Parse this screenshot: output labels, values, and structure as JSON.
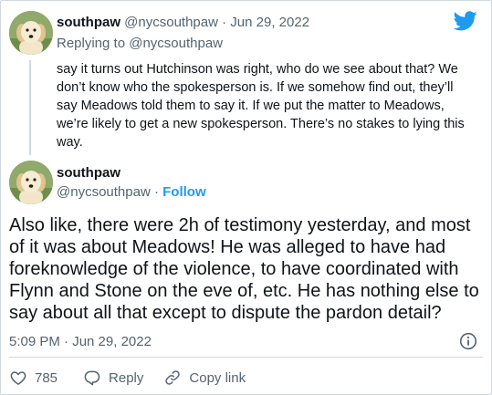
{
  "colors": {
    "accent": "#1d9bf0",
    "muted": "#536471",
    "text": "#0f1419",
    "border": "#cfd9de"
  },
  "icons": {
    "brand": "twitter-bird-icon",
    "info": "info-icon",
    "like": "heart-icon",
    "reply": "reply-icon",
    "copy": "link-icon"
  },
  "parent_tweet": {
    "name": "southpaw",
    "handle": "@nycsouthpaw",
    "separator": " · ",
    "date": "Jun 29, 2022",
    "replying_prefix": "Replying to ",
    "replying_to": "@nycsouthpaw",
    "text": "say it turns out Hutchinson was right, who do we see about that? We don’t know who the spokesperson is. If we somehow find out, they’ll say Meadows told them to say it. If we put the matter to Meadows, we’re likely to get a new spokesperson. There’s no stakes to lying this way."
  },
  "main_tweet": {
    "name": "southpaw",
    "handle": "@nycsouthpaw",
    "separator": " · ",
    "follow_label": "Follow",
    "text": "Also like, there were 2h of testimony yesterday, and most of it was about Meadows! He was alleged to have had foreknowledge of the violence, to have coordinated with Flynn and Stone on the eve of, etc. He has nothing else to say about all that except to dispute the pardon detail?",
    "timestamp": "5:09 PM · Jun 29, 2022",
    "likes": "785",
    "reply_label": "Reply",
    "copy_link_label": "Copy link"
  }
}
